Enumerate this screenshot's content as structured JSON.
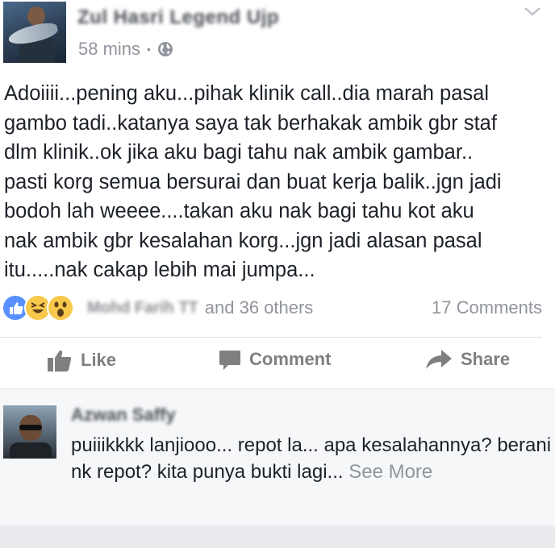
{
  "post": {
    "author_name": "Zul Hasri Legend Ujp",
    "time": "58 mins",
    "separator": "•",
    "privacy_icon": "globe-icon",
    "menu_icon": "chevron-down-icon",
    "text": "Adoiiii...pening aku...pihak klinik call..dia marah pasal\ngambo tadi..katanya saya tak berhakak ambik gbr staf\ndlm klinik..ok jika aku bagi tahu nak ambik gambar..\npasti korg semua bersurai dan buat kerja balik..jgn jadi\nbodoh lah weeee....takan aku nak bagi tahu kot aku\nnak ambik gbr kesalahan korg...jgn jadi alasan pasal\nitu.....nak cakap lebih mai jumpa..."
  },
  "reactions": {
    "icons": [
      "like-reaction-icon",
      "haha-reaction-icon",
      "wow-reaction-icon"
    ],
    "reactor_name": "Mohd Farih TT",
    "others_text": "and 36 others",
    "comments_count": "17 Comments"
  },
  "actions": {
    "like_label": "Like",
    "comment_label": "Comment",
    "share_label": "Share"
  },
  "comment": {
    "author_name": "Azwan Saffy",
    "text": "puiiikkkk lanjiooo... repot la... apa kesalahannya? berani nk repot? kita punya bukti lagi...",
    "see_more": "See More"
  },
  "colors": {
    "text": "#1d2129",
    "meta": "#90949c",
    "action": "#7f7f7f",
    "like_blue": "#5890ff",
    "emoji_yellow": "#f7c84b"
  }
}
